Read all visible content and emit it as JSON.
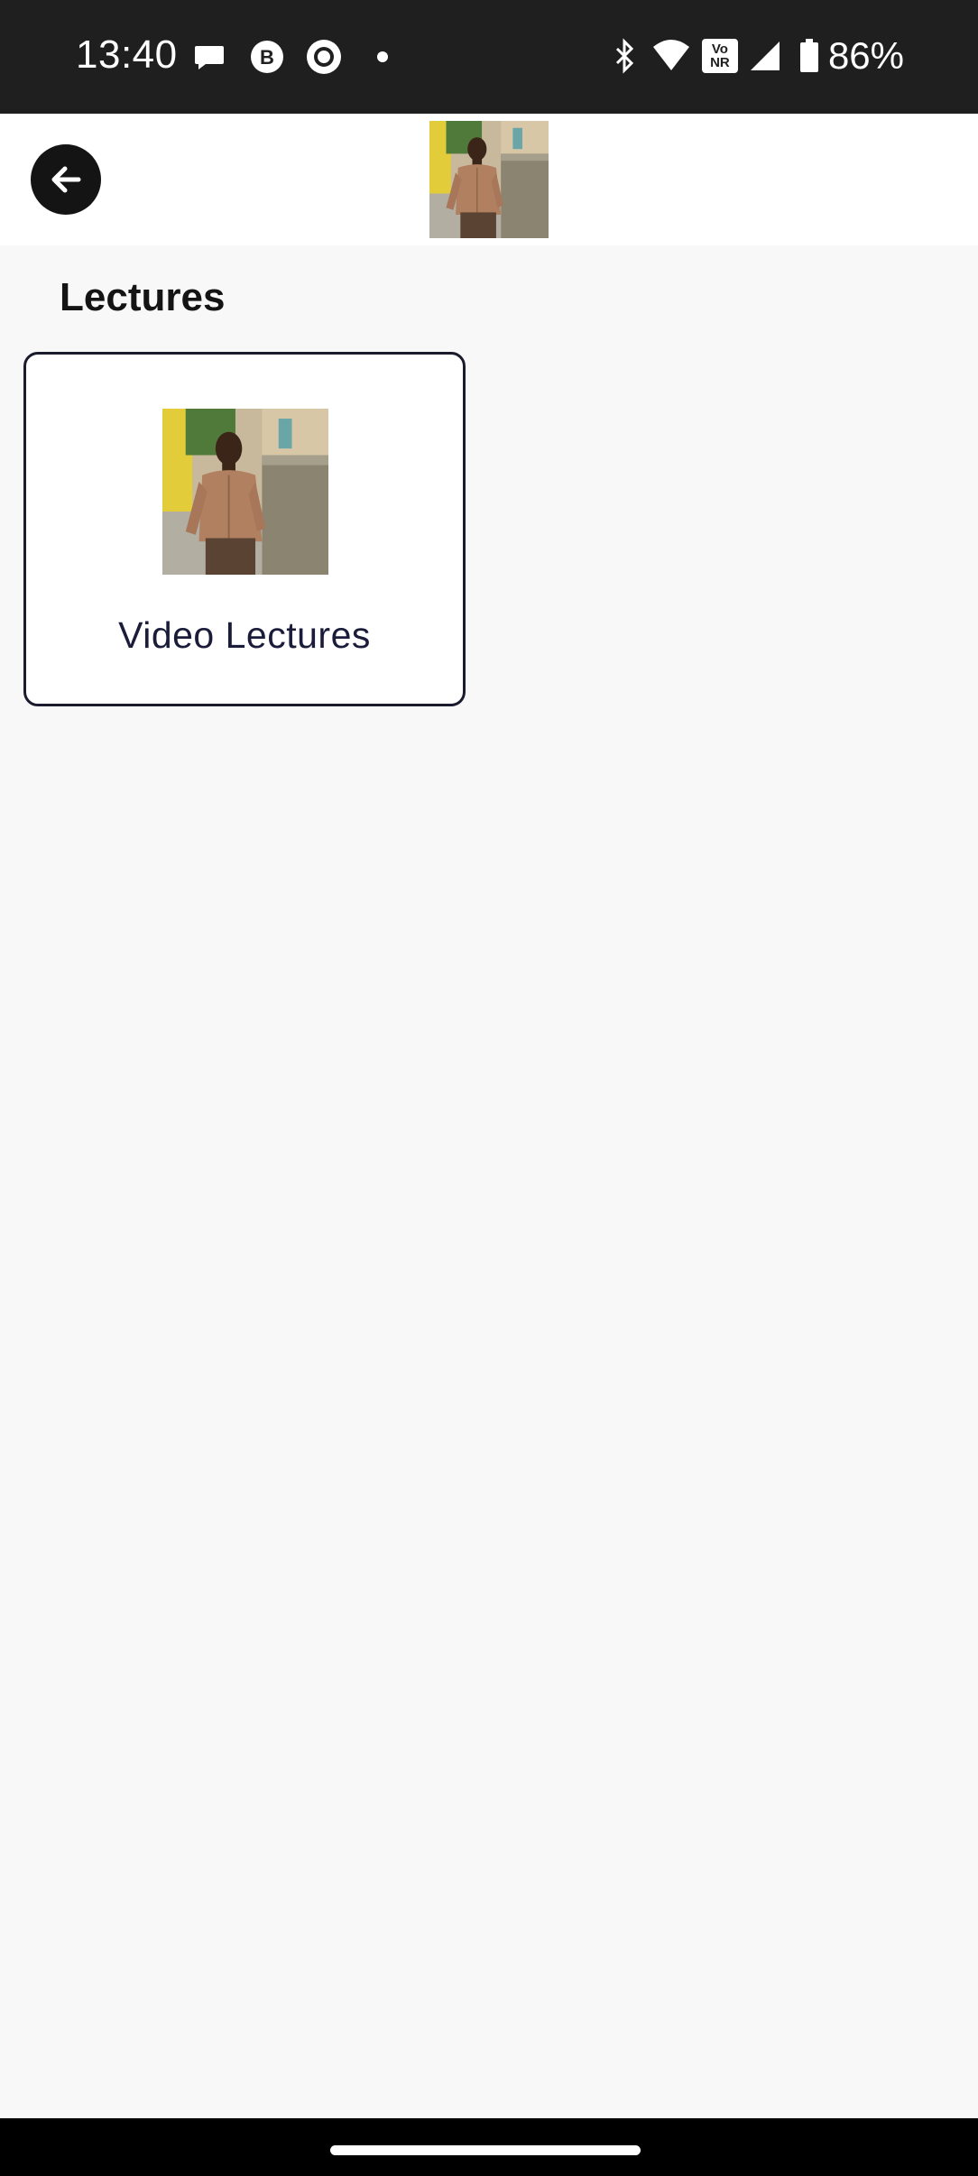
{
  "status_bar": {
    "time": "13:40",
    "left_icons": [
      "chat-bubble-icon",
      "b-circle-icon",
      "ring-icon",
      "dot-icon"
    ],
    "right_icons": [
      "bluetooth-icon",
      "wifi-icon",
      "vonr-icon",
      "signal-icon",
      "battery-icon"
    ],
    "vonr_top": "Vo",
    "vonr_bottom": "NR",
    "battery": "86%"
  },
  "header": {
    "back_icon": "arrow-left-icon",
    "logo": "profile-photo"
  },
  "main": {
    "title": "Lectures",
    "cards": [
      {
        "label": "Video Lectures",
        "thumbnail": "profile-photo"
      }
    ]
  },
  "colors": {
    "status_bar_bg": "#1f1f1f",
    "page_bg": "#f8f8f8",
    "card_border": "#1b1b2e",
    "card_label": "#1a1c3a"
  }
}
